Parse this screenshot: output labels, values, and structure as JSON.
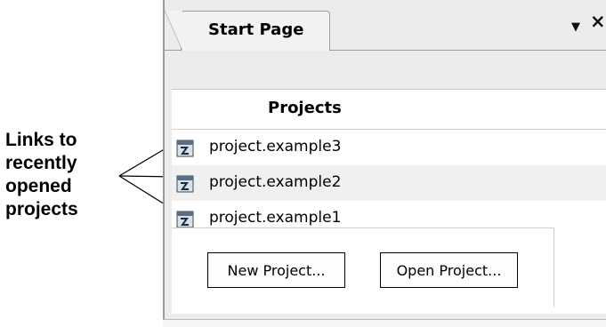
{
  "callout": {
    "lines": [
      "Links to",
      "recently",
      "opened",
      "projects"
    ]
  },
  "tab": {
    "title": "Start Page",
    "dropdown_glyph": "▼",
    "close_glyph": "×"
  },
  "projects": {
    "header": "Projects",
    "items": [
      {
        "label": "project.example3",
        "icon": "project-file-icon"
      },
      {
        "label": "project.example2",
        "icon": "project-file-icon"
      },
      {
        "label": "project.example1",
        "icon": "project-file-icon"
      }
    ]
  },
  "buttons": {
    "new_project": "New Project...",
    "open_project": "Open Project..."
  },
  "colors": {
    "panel_bg": "#ececec",
    "content_bg": "#ffffff",
    "alt_row": "#f0f0f0"
  }
}
